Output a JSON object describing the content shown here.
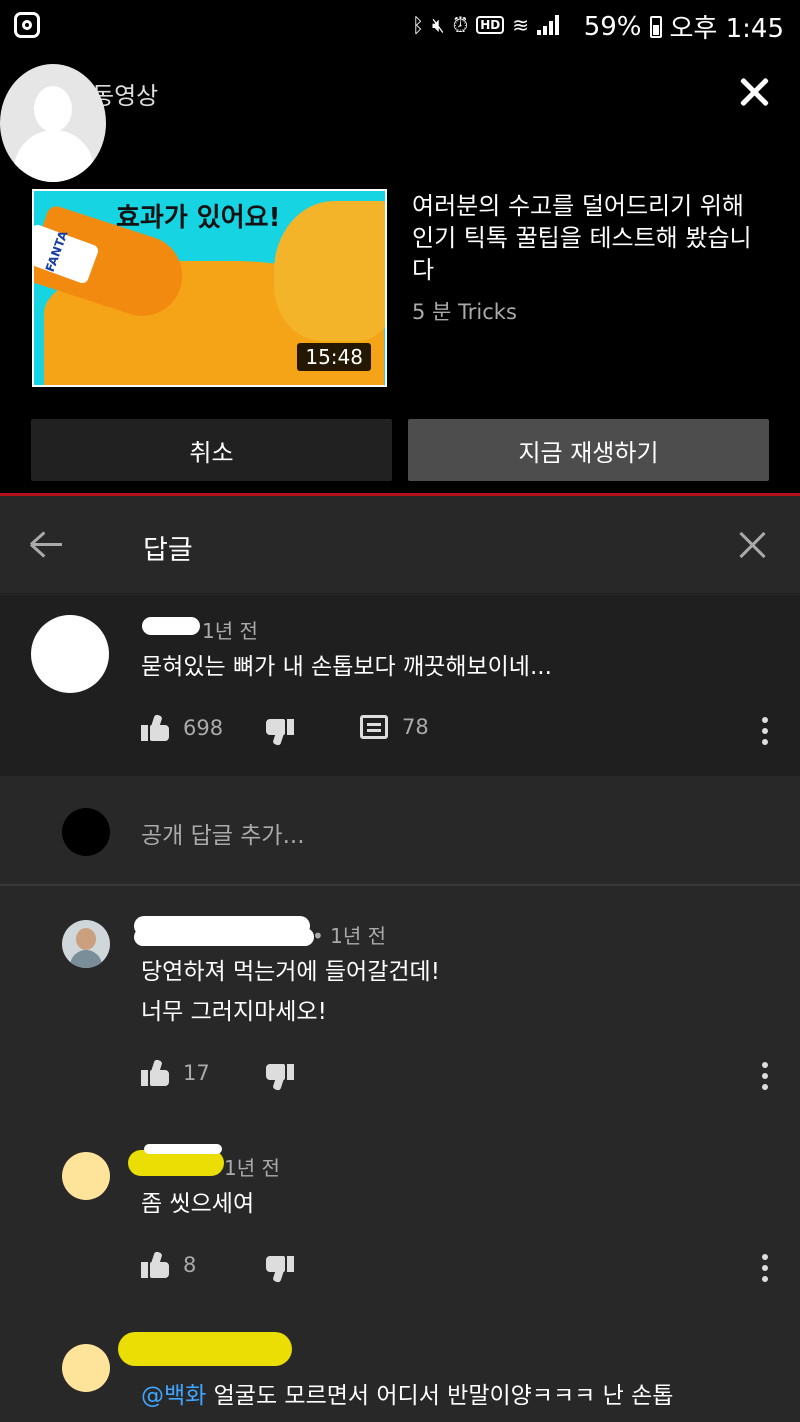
{
  "status_bar": {
    "battery": "59%",
    "time": "오후 1:45",
    "hd_badge": "HD"
  },
  "up_next": {
    "label": "동영상",
    "thumbnail_headline": "효과가 있어요!",
    "thumbnail_brand": "FANTA",
    "duration": "15:48",
    "title": "여러분의 수고를 덜어드리기 위해 인기 틱톡 꿀팁을 테스트해 봤습니다",
    "meta": "5 분 Tricks",
    "cancel_label": "취소",
    "play_label": "지금 재생하기"
  },
  "replies_panel": {
    "title": "답글",
    "top_comment": {
      "time": "1년 전",
      "text": "묻혀있는 뼈가 내 손톱보다 깨끗해보이네...",
      "likes": "698",
      "reply_count": "78"
    },
    "add_reply_placeholder": "공개 답글 추가...",
    "replies": [
      {
        "time": "• 1년 전",
        "text_line1": "당연하져 먹는거에 들어갈건데!",
        "text_line2": "너무 그러지마세오!",
        "likes": "17"
      },
      {
        "time": "1년 전",
        "text_line1": "좀 씻으세여",
        "likes": "8"
      },
      {
        "mention": "@백화",
        "text_line1": " 얼굴도 모르면서 어디서 반말이양ㅋㅋㅋ 난 손톱"
      }
    ]
  },
  "colors": {
    "accent_red": "#b4121b",
    "mention_blue": "#3ea6ff",
    "panel_bg": "#282828",
    "top_comment_bg": "#1f1f1f"
  }
}
